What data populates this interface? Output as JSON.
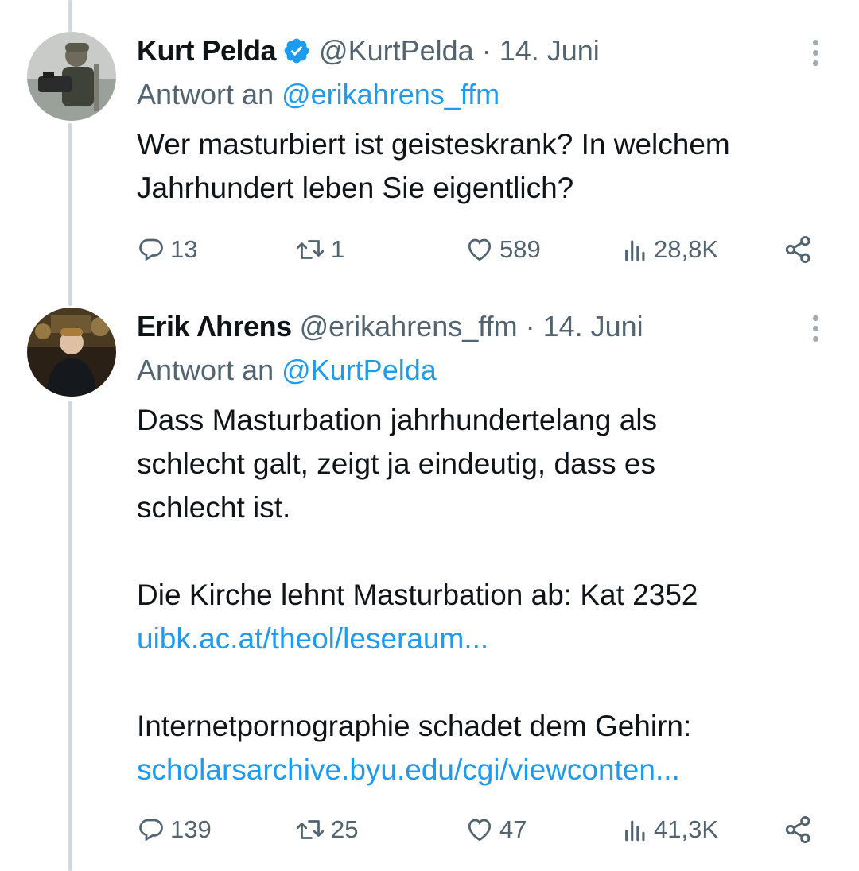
{
  "colors": {
    "accent": "#1d9bf0",
    "text": "#0f1419",
    "muted": "#536471",
    "line": "#cfd9de"
  },
  "tweets": [
    {
      "name": "Kurt Pelda",
      "verified": true,
      "handle": "@KurtPelda",
      "separator": "·",
      "date": "14. Juni",
      "reply_prefix": "Antwort an",
      "reply_to": "@erikahrens_ffm",
      "paragraphs": [
        {
          "text": "Wer masturbiert ist geisteskrank? In welchem",
          "type": "text"
        },
        {
          "text": "Jahrhundert leben Sie eigentlich?",
          "type": "text"
        }
      ],
      "stats": {
        "replies": "13",
        "reposts": "1",
        "likes": "589",
        "views": "28,8K"
      }
    },
    {
      "name": "Erik Λhrens",
      "verified": false,
      "handle": "@erikahrens_ffm",
      "separator": "·",
      "date": "14. Juni",
      "reply_prefix": "Antwort an",
      "reply_to": "@KurtPelda",
      "lines": {
        "l1": "Dass Masturbation jahrhundertelang als",
        "l2": "schlecht galt, zeigt ja eindeutig, dass es",
        "l3": "schlecht ist.",
        "l4": "Die Kirche lehnt Masturbation ab: Kat 2352",
        "link1": "uibk.ac.at/theol/leseraum...",
        "l5": "Internetpornographie schadet dem Gehirn:",
        "link2": "scholarsarchive.byu.edu/cgi/viewconten..."
      },
      "stats": {
        "replies": "139",
        "reposts": "25",
        "likes": "47",
        "views": "41,3K"
      }
    }
  ],
  "icons": [
    "reply-icon",
    "repost-icon",
    "like-icon",
    "views-icon",
    "share-icon",
    "more-icon",
    "verified-icon"
  ]
}
